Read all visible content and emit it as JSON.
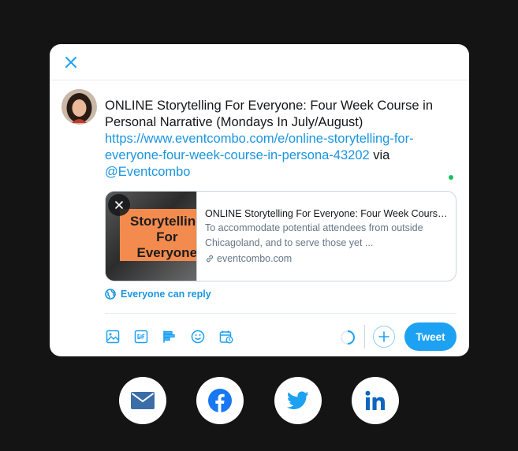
{
  "composer": {
    "tweet_title": "ONLINE Storytelling For Everyone: Four Week Course in Personal Narrative (Mondays In July/August)",
    "tweet_url": "https://www.eventcombo.com/e/online-storytelling-for-everyone-four-week-course-in-persona-43202",
    "tweet_via": "via",
    "tweet_mention": "@Eventcombo",
    "reply_setting": "Everyone can reply",
    "tweet_button": "Tweet"
  },
  "card": {
    "thumb_text": "Storytelling\nFor\nEveryone",
    "title": "ONLINE Storytelling For Everyone: Four Week Course in Personal Narrative (Mondays In July/August)",
    "description": "To accommodate potential attendees from outside Chicagoland, and to serve those yet ...",
    "domain": "eventcombo.com"
  },
  "toolbar": {
    "icons": [
      "image-icon",
      "gif-icon",
      "poll-icon",
      "emoji-icon",
      "schedule-icon"
    ]
  },
  "share": {
    "buttons": [
      "email",
      "facebook",
      "twitter",
      "linkedin"
    ]
  },
  "colors": {
    "accent": "#1da1f2",
    "link": "#1b95e0",
    "facebook": "#1877f2",
    "linkedin": "#0a66c2",
    "email": "#3b6ea8",
    "status_dot": "#17bf63"
  }
}
